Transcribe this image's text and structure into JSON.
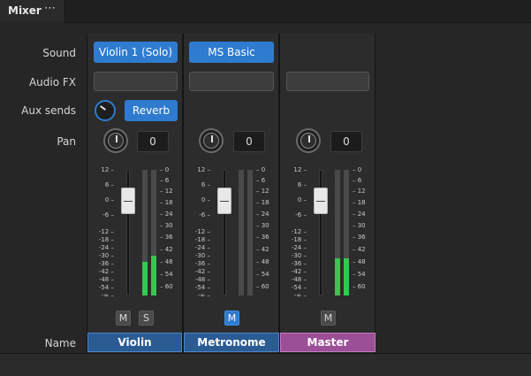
{
  "tab": {
    "title": "Mixer",
    "menu_glyph": "⋯"
  },
  "row_labels": {
    "sound": "Sound",
    "audio_fx": "Audio FX",
    "aux_sends": "Aux sends",
    "pan": "Pan",
    "name": "Name"
  },
  "channels": [
    {
      "name": "Violin",
      "sound": "Violin 1 (Solo)",
      "aux_send_label": "Reverb",
      "pan_value": "0",
      "mute_label": "M",
      "solo_label": "S",
      "mute_on": false,
      "meter_levels_db": [
        -44,
        -42
      ]
    },
    {
      "name": "Metronome",
      "sound": "MS Basic",
      "pan_value": "0",
      "mute_label": "M",
      "mute_on": true,
      "meter_levels_db": []
    },
    {
      "name": "Master",
      "pan_value": "0",
      "mute_label": "M",
      "mute_on": false,
      "meter_levels_db": [
        -42,
        -42
      ]
    }
  ],
  "fader_scale_left": [
    "12",
    "6",
    "0",
    "-6",
    "-12",
    "-18",
    "-24",
    "-30",
    "-36",
    "-42",
    "-48",
    "-54",
    "-∞"
  ],
  "meter_scale_right": [
    "0",
    "6",
    "12",
    "18",
    "24",
    "30",
    "36",
    "42",
    "48",
    "54",
    "60"
  ],
  "colors": {
    "accent_blue": "#2f7bd0",
    "master_pink": "#9b4f97",
    "meter_green": "#37c650"
  }
}
